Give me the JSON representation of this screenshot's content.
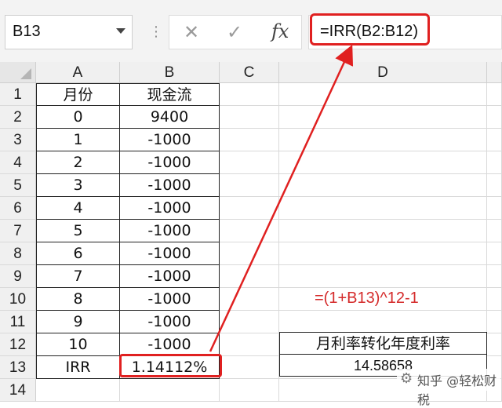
{
  "formula_bar": {
    "name_box": "B13",
    "separator": "⋮",
    "cancel_icon": "✕",
    "enter_icon": "✓",
    "fx_icon": "fx",
    "formula": "=IRR(B2:B12)"
  },
  "columns": [
    "A",
    "B",
    "C",
    "D"
  ],
  "rows": [
    {
      "num": "1",
      "a": "月份",
      "b": "现金流"
    },
    {
      "num": "2",
      "a": "0",
      "b": "9400"
    },
    {
      "num": "3",
      "a": "1",
      "b": "-1000"
    },
    {
      "num": "4",
      "a": "2",
      "b": "-1000"
    },
    {
      "num": "5",
      "a": "3",
      "b": "-1000"
    },
    {
      "num": "6",
      "a": "4",
      "b": "-1000"
    },
    {
      "num": "7",
      "a": "5",
      "b": "-1000"
    },
    {
      "num": "8",
      "a": "6",
      "b": "-1000"
    },
    {
      "num": "9",
      "a": "7",
      "b": "-1000"
    },
    {
      "num": "10",
      "a": "8",
      "b": "-1000"
    },
    {
      "num": "11",
      "a": "9",
      "b": "-1000"
    },
    {
      "num": "12",
      "a": "10",
      "b": "-1000"
    },
    {
      "num": "13",
      "a": "IRR",
      "b": "1.14112%"
    },
    {
      "num": "14",
      "a": "",
      "b": ""
    }
  ],
  "annotation": {
    "formula_note": "=(1+B13)^12-1",
    "box_title": "月利率转化年度利率",
    "box_value": "14.58658"
  },
  "watermark": {
    "icon": "⚙",
    "text": "知乎 @轻松财税"
  },
  "colors": {
    "highlight": "#e02020",
    "note": "#d42a2a"
  }
}
